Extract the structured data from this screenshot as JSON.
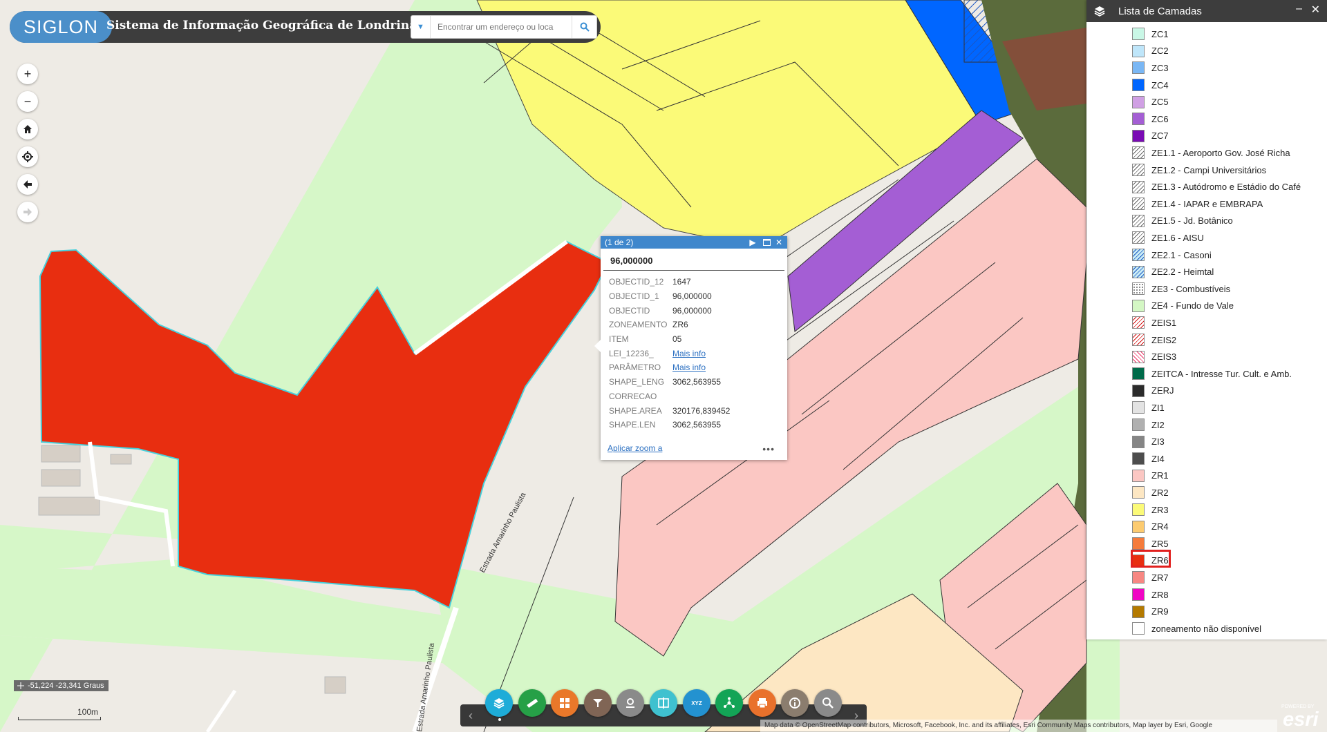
{
  "app": {
    "logo_text": "SIGLON",
    "title": "Sistema de Informação Geográfica de Londrina"
  },
  "search": {
    "placeholder": "Encontrar um endereço ou loca"
  },
  "popup": {
    "counter": "(1 de 2)",
    "heading": "96,000000",
    "fields": [
      {
        "key": "OBJECTID_12",
        "value": "1647"
      },
      {
        "key": "OBJECTID_1",
        "value": "96,000000"
      },
      {
        "key": "OBJECTID",
        "value": "96,000000"
      },
      {
        "key": "ZONEAMENTO",
        "value": "ZR6"
      },
      {
        "key": "ITEM",
        "value": "05"
      },
      {
        "key": "LEI_12236_",
        "value": "Mais info",
        "link": true
      },
      {
        "key": "PARÂMETRO",
        "value": "Mais info",
        "link": true
      },
      {
        "key": "SHAPE_LENG",
        "value": "3062,563955"
      },
      {
        "key": "CORRECAO",
        "value": ""
      },
      {
        "key": "SHAPE.AREA",
        "value": "320176,839452"
      },
      {
        "key": "SHAPE.LEN",
        "value": "3062,563955"
      }
    ],
    "zoom_label": "Aplicar zoom a",
    "more_label": "•••"
  },
  "layer_panel": {
    "title": "Lista de Camadas",
    "items": [
      {
        "label": "ZC1",
        "color": "#c9f7e6"
      },
      {
        "label": "ZC2",
        "color": "#bfe6fa"
      },
      {
        "label": "ZC3",
        "color": "#7ab7f4"
      },
      {
        "label": "ZC4",
        "color": "#0066ff"
      },
      {
        "label": "ZC5",
        "color": "#d0a0e4"
      },
      {
        "label": "ZC6",
        "color": "#a45ed4"
      },
      {
        "label": "ZC7",
        "color": "#7a0bb4"
      },
      {
        "label": "ZE1.1 - Aeroporto Gov. José Richa",
        "color": "hatch"
      },
      {
        "label": "ZE1.2 - Campi Universitários",
        "color": "hatch"
      },
      {
        "label": "ZE1.3 - Autódromo e Estádio do Café",
        "color": "hatch"
      },
      {
        "label": "ZE1.4 - IAPAR e EMBRAPA",
        "color": "hatch"
      },
      {
        "label": "ZE1.5 - Jd. Botânico",
        "color": "hatch"
      },
      {
        "label": "ZE1.6 - AISU",
        "color": "hatch"
      },
      {
        "label": "ZE2.1 - Casoni",
        "color": "hatch-blue"
      },
      {
        "label": "ZE2.2 - Heimtal",
        "color": "hatch-blue"
      },
      {
        "label": "ZE3 - Combustíveis",
        "color": "dots"
      },
      {
        "label": "ZE4 - Fundo de Vale",
        "color": "#d4f7c4"
      },
      {
        "label": "ZEIS1",
        "color": "hatch-red"
      },
      {
        "label": "ZEIS2",
        "color": "hatch-red"
      },
      {
        "label": "ZEIS3",
        "color": "hatch-cross-red"
      },
      {
        "label": "ZEITCA - Intresse Tur. Cult. e Amb.",
        "color": "#006b4a"
      },
      {
        "label": "ZERJ",
        "color": "#2b2b2b"
      },
      {
        "label": "ZI1",
        "color": "#e3e3e3"
      },
      {
        "label": "ZI2",
        "color": "#b0b0b0"
      },
      {
        "label": "ZI3",
        "color": "#858585"
      },
      {
        "label": "ZI4",
        "color": "#4d4d4d"
      },
      {
        "label": "ZR1",
        "color": "#fbc7c3"
      },
      {
        "label": "ZR2",
        "color": "#fde7c3"
      },
      {
        "label": "ZR3",
        "color": "#fbfa78"
      },
      {
        "label": "ZR4",
        "color": "#fccb70"
      },
      {
        "label": "ZR5",
        "color": "#f57b3b"
      },
      {
        "label": "ZR6",
        "color": "#e82e10"
      },
      {
        "label": "ZR7",
        "color": "#f78782"
      },
      {
        "label": "ZR8",
        "color": "#f005c4"
      },
      {
        "label": "ZR9",
        "color": "#b47a00"
      },
      {
        "label": "zoneamento não disponível",
        "color": "#ffffff"
      }
    ]
  },
  "coordinates": "-51,224 -23,341 Graus",
  "scale": "100m",
  "map_labels": {
    "road_1": "Estrada Amarinho Paulista",
    "road_2": "Estrada Amarinho Paulista"
  },
  "attribution": "Map data © OpenStreetMap contributors, Microsoft, Facebook, Inc. and its affiliates, Esri Community Maps contributors, Map layer by Esri, Google",
  "esri": {
    "powered": "POWERED BY",
    "name": "esri"
  },
  "toolbar": {
    "tools": [
      {
        "name": "layer-list-tool",
        "color": "#1eacd8"
      },
      {
        "name": "measure-tool",
        "color": "#26a047"
      },
      {
        "name": "basemap-gallery-tool",
        "color": "#e9782a"
      },
      {
        "name": "filter-tool",
        "color": "#806555"
      },
      {
        "name": "location-tool",
        "color": "#8a8a8a"
      },
      {
        "name": "swipe-tool",
        "color": "#3fc1cf"
      },
      {
        "name": "coordinate-tool",
        "color": "#2392d0"
      },
      {
        "name": "share-tool",
        "color": "#13a456"
      },
      {
        "name": "print-tool",
        "color": "#e9712c"
      },
      {
        "name": "about-tool",
        "color": "#8b7d6e"
      },
      {
        "name": "query-tool",
        "color": "#8a8a8a"
      }
    ]
  }
}
